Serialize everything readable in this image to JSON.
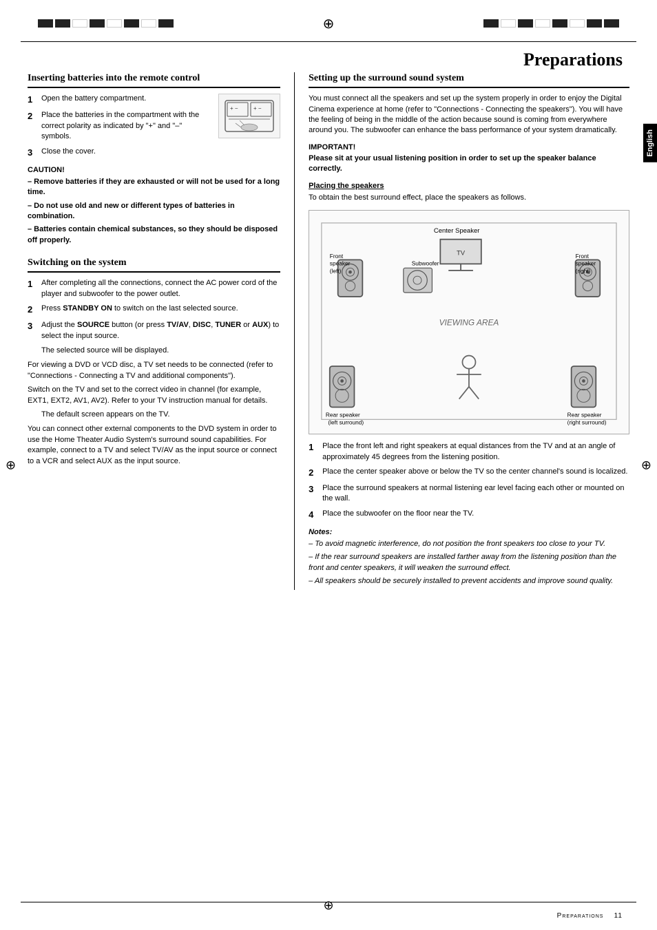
{
  "page": {
    "title": "Preparations",
    "footer": "Preparations",
    "page_number": "11",
    "language_tab": "English"
  },
  "left_column": {
    "section1": {
      "title": "Inserting batteries into the remote control",
      "steps": [
        {
          "num": "1",
          "text": "Open the battery compartment."
        },
        {
          "num": "2",
          "text": "Place the batteries in the compartment with the correct polarity as indicated by \"+\" and \"–\" symbols."
        },
        {
          "num": "3",
          "text": "Close the cover."
        }
      ],
      "caution": {
        "title": "CAUTION!",
        "items": [
          "– Remove batteries if they are exhausted or will not be used for a long time.",
          "– Do not use old and new or different types of batteries in combination.",
          "– Batteries contain chemical substances, so they should be disposed off properly."
        ]
      }
    },
    "section2": {
      "title": "Switching on the system",
      "steps": [
        {
          "num": "1",
          "text": "After completing all the connections, connect the AC power cord of the player and subwoofer to the power outlet."
        },
        {
          "num": "2",
          "text_plain": "Press ",
          "text_bold": "STANDBY ON",
          "text_after": " to switch on the last selected source."
        },
        {
          "num": "3",
          "text_plain": "Adjust the ",
          "text_bold1": "SOURCE",
          "text_mid1": " button (or press ",
          "text_bold2": "TV/AV",
          "text_mid2": ", ",
          "text_bold3": "DISC",
          "text_mid3": ", ",
          "text_bold4": "TUNER",
          "text_mid4": " or ",
          "text_bold5": "AUX",
          "text_after": ") to select the input source."
        }
      ],
      "step3_sub": "The selected source will be displayed.",
      "para1": "For viewing a DVD or VCD disc, a TV set needs to be connected (refer to \"Connections - Connecting a TV and additional components\").",
      "para2": "Switch on the TV and set to the correct video in channel (for example, EXT1, EXT2, AV1, AV2). Refer to your TV instruction manual for details.",
      "para2_sub": "The default screen appears on the TV.",
      "para3": "You can connect other external components to the DVD system in order to use the Home Theater Audio System's surround sound capabilities. For example, connect to a TV and select TV/AV as the input source or connect to a VCR and select AUX as the input source."
    }
  },
  "right_column": {
    "section1": {
      "title": "Setting up the surround sound system",
      "intro": "You must connect all the speakers and set up the system properly in order to enjoy the Digital Cinema experience at home (refer to \"Connections - Connecting the speakers\"). You will have the feeling of being in the middle of the action because sound is coming from everywhere around you. The subwoofer can enhance the bass performance of your system dramatically.",
      "important": {
        "title": "IMPORTANT!",
        "text": "Please sit at your usual listening position in order to set up the speaker balance correctly."
      },
      "placing": {
        "title": "Placing the speakers",
        "intro": "To obtain the best surround effect, place the speakers as follows.",
        "diagram": {
          "labels": {
            "center_speaker": "Center Speaker",
            "front_left": "Front speaker (left)",
            "front_right": "Front speaker (right)",
            "subwoofer": "Subwoofer",
            "tv": "TV",
            "viewing_area": "VIEWING AREA",
            "rear_left": "Rear speaker (left surround)",
            "rear_right": "Rear speaker (right surround)"
          }
        },
        "steps": [
          {
            "num": "1",
            "text": "Place the front left and right speakers at equal distances from the TV and at an angle of approximately 45 degrees from the listening position."
          },
          {
            "num": "2",
            "text": "Place the center speaker above or below the TV so the center channel's sound is localized."
          },
          {
            "num": "3",
            "text": "Place the surround speakers at normal listening ear level facing each other or mounted on the wall."
          },
          {
            "num": "4",
            "text": "Place the subwoofer on the floor near the TV."
          }
        ],
        "notes": {
          "title": "Notes:",
          "items": [
            "– To avoid magnetic interference, do not position the front speakers too close to your TV.",
            "– If the rear surround speakers are installed farther away from the listening position than the front and center speakers, it will weaken the surround effect.",
            "– All speakers should be securely installed to prevent accidents and improve sound quality."
          ]
        }
      }
    }
  }
}
